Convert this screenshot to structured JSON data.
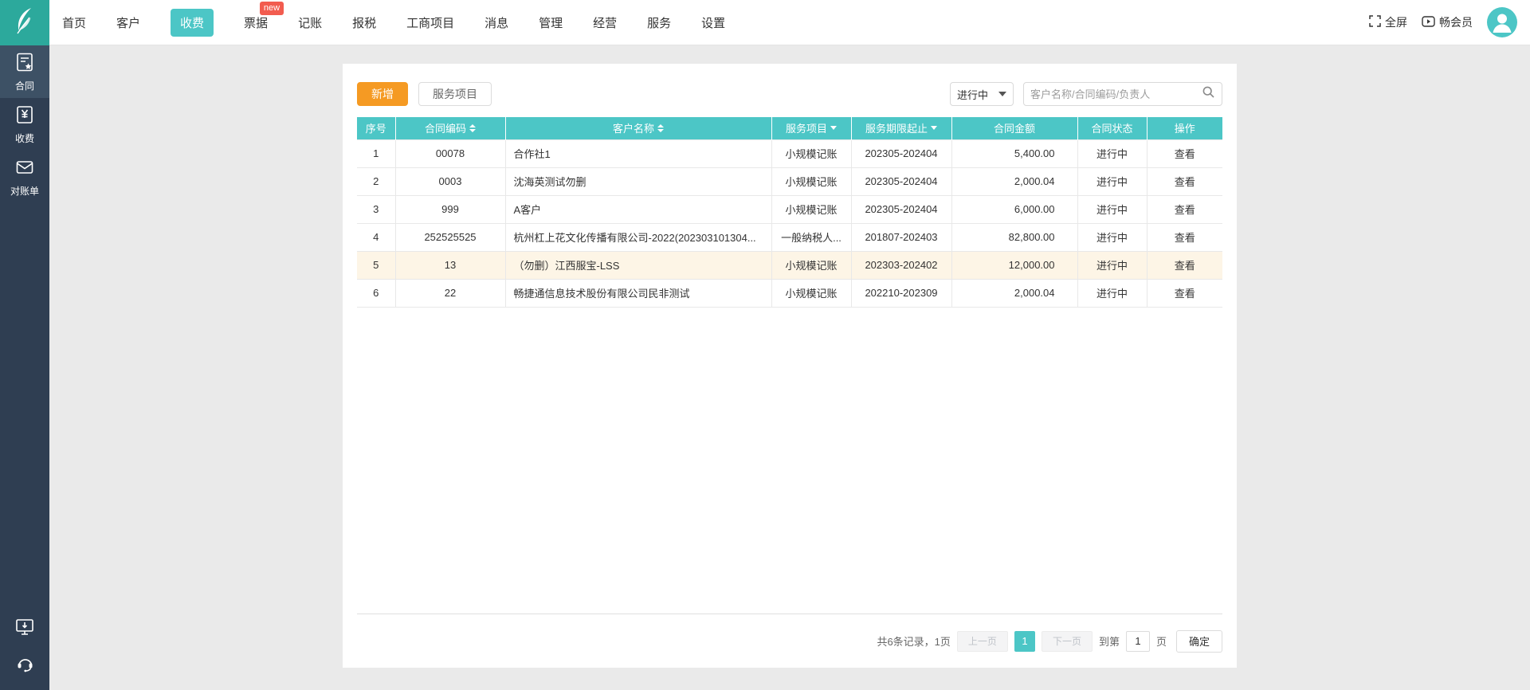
{
  "colors": {
    "teal_accent": "#4cc6c6",
    "logo_teal": "#2ca99c",
    "sidebar_bg": "#2f3e52",
    "sidebar_active_bg": "#3d5165",
    "add_button_orange": "#f59a23",
    "new_badge_red": "#f25c4f",
    "highlight_row_bg": "#fdf5e6"
  },
  "icons": {
    "logo": "quill-leaf-icon",
    "fullscreen": "fullscreen-icon",
    "member": "video-play-icon",
    "avatar": "user-avatar-icon",
    "sidebar": [
      "contract-doc-icon",
      "fee-yuan-icon",
      "statement-inbox-icon"
    ],
    "sidebar_bottom": [
      "client-download-icon",
      "support-headset-icon"
    ],
    "search": "search-icon"
  },
  "nav": {
    "items": [
      {
        "label": "首页"
      },
      {
        "label": "客户"
      },
      {
        "label": "收费",
        "active": true
      },
      {
        "label": "票据",
        "badge": "new"
      },
      {
        "label": "记账"
      },
      {
        "label": "报税"
      },
      {
        "label": "工商项目"
      },
      {
        "label": "消息"
      },
      {
        "label": "管理"
      },
      {
        "label": "经营"
      },
      {
        "label": "服务"
      },
      {
        "label": "设置"
      }
    ],
    "fullscreen_label": "全屏",
    "member_label": "畅会员"
  },
  "sidebar": {
    "items": [
      {
        "label": "合同",
        "active": true
      },
      {
        "label": "收费"
      },
      {
        "label": "对账单"
      }
    ]
  },
  "toolbar": {
    "add_label": "新增",
    "service_items_label": "服务项目",
    "status_filter_value": "进行中",
    "search_placeholder": "客户名称/合同编码/负责人"
  },
  "table": {
    "columns": [
      {
        "label": "序号"
      },
      {
        "label": "合同编码",
        "sortable": true
      },
      {
        "label": "客户名称",
        "sortable": true
      },
      {
        "label": "服务项目",
        "filterable": true
      },
      {
        "label": "服务期限起止",
        "filterable": true
      },
      {
        "label": "合同金额"
      },
      {
        "label": "合同状态"
      },
      {
        "label": "操作"
      }
    ],
    "rows": [
      {
        "index": "1",
        "code": "00078",
        "customer": "合作社1",
        "service": "小规模记账",
        "period": "202305-202404",
        "amount": "5,400.00",
        "status": "进行中",
        "action": "查看"
      },
      {
        "index": "2",
        "code": "0003",
        "customer": "沈海英测试勿删",
        "service": "小规模记账",
        "period": "202305-202404",
        "amount": "2,000.04",
        "status": "进行中",
        "action": "查看"
      },
      {
        "index": "3",
        "code": "999",
        "customer": "A客户",
        "service": "小规模记账",
        "period": "202305-202404",
        "amount": "6,000.00",
        "status": "进行中",
        "action": "查看"
      },
      {
        "index": "4",
        "code": "252525525",
        "customer": "杭州杠上花文化传播有限公司-2022(202303101304...",
        "service": "一般纳税人...",
        "period": "201807-202403",
        "amount": "82,800.00",
        "status": "进行中",
        "action": "查看"
      },
      {
        "index": "5",
        "code": "13",
        "customer": "（勿删）江西服宝-LSS",
        "service": "小规模记账",
        "period": "202303-202402",
        "amount": "12,000.00",
        "status": "进行中",
        "action": "查看",
        "highlight": true
      },
      {
        "index": "6",
        "code": "22",
        "customer": "畅捷通信息技术股份有限公司民非测试",
        "service": "小规模记账",
        "period": "202210-202309",
        "amount": "2,000.04",
        "status": "进行中",
        "action": "查看"
      }
    ]
  },
  "pagination": {
    "summary": "共6条记录，1页",
    "prev_label": "上一页",
    "current_page": "1",
    "next_label": "下一页",
    "goto_prefix": "到第",
    "goto_value": "1",
    "goto_suffix": "页",
    "confirm_label": "确定"
  }
}
